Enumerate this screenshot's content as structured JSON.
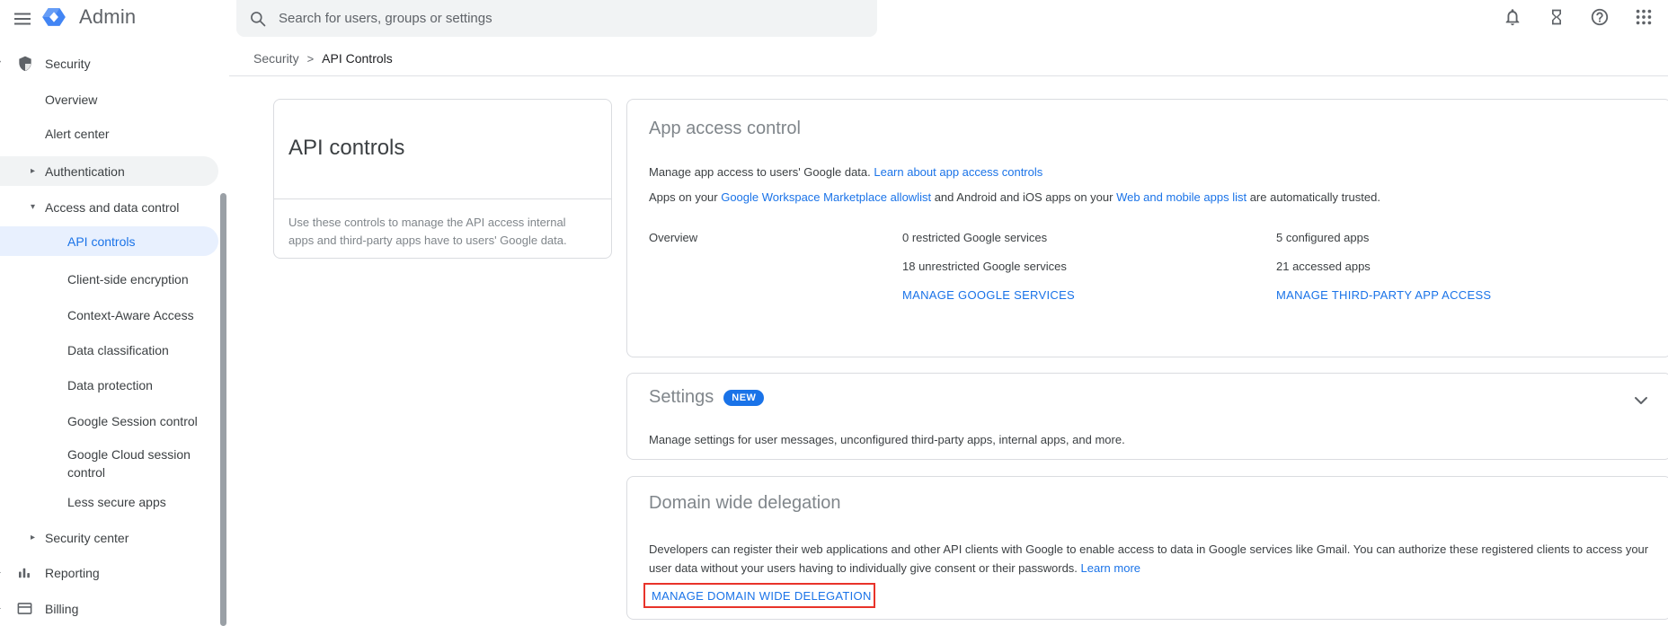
{
  "header": {
    "title": "Admin",
    "search_placeholder": "Search for users, groups or settings"
  },
  "icons": {
    "menu": "hamburger",
    "search": "magnifier",
    "notifications": "bell",
    "tasks": "hourglass",
    "help": "question-mark-circle",
    "apps": "3x3-dot-grid",
    "security": "shield",
    "reporting": "bar-chart",
    "billing": "credit-card",
    "caret_down": "▾",
    "caret_right": "▸",
    "chevron_down": "expand-chevron"
  },
  "breadcrumb": {
    "parent": "Security",
    "separator": ">",
    "current": "API Controls"
  },
  "sidebar": {
    "items": [
      {
        "label": "Security"
      },
      {
        "label": "Overview"
      },
      {
        "label": "Alert center"
      },
      {
        "label": "Authentication"
      },
      {
        "label": "Access and data control"
      },
      {
        "label": "API controls",
        "selected": true
      },
      {
        "label": "Client-side encryption"
      },
      {
        "label": "Context-Aware Access"
      },
      {
        "label": "Data classification"
      },
      {
        "label": "Data protection"
      },
      {
        "label": "Google Session control"
      },
      {
        "label": "Google Cloud session control"
      },
      {
        "label": "Less secure apps"
      },
      {
        "label": "Security center"
      },
      {
        "label": "Reporting"
      },
      {
        "label": "Billing"
      }
    ]
  },
  "api_controls_card": {
    "title": "API controls",
    "description": "Use these controls to manage the API access internal apps and third-party apps have to users' Google data."
  },
  "app_access_control": {
    "title": "App access control",
    "line1_text": "Manage app access to users' Google data. ",
    "line1_link": "Learn about app access controls",
    "line2_seg1": "Apps on your ",
    "line2_link1": "Google Workspace Marketplace allowlist",
    "line2_seg2": " and Android and iOS apps on your ",
    "line2_link2": "Web and mobile apps list",
    "line2_seg3": " are automatically trusted.",
    "overview_label": "Overview",
    "google_services_stat1": "0 restricted Google services",
    "google_services_stat2": "18 unrestricted Google services",
    "google_services_action": "MANAGE GOOGLE SERVICES",
    "apps_stat1": "5 configured apps",
    "apps_stat2": "21 accessed apps",
    "apps_action": "MANAGE THIRD-PARTY APP ACCESS"
  },
  "settings": {
    "title": "Settings",
    "badge": "NEW",
    "description": "Manage settings for user messages, unconfigured third-party apps, internal apps, and more."
  },
  "domain_wide_delegation": {
    "title": "Domain wide delegation",
    "description": "Developers can register their web applications and other API clients with Google to enable access to data in Google services like Gmail. You can authorize these registered clients to access your user data without your users having to individually give consent or their passwords. ",
    "link": "Learn more",
    "action": "MANAGE DOMAIN WIDE DELEGATION"
  },
  "colors": {
    "accent": "#1a73e8",
    "selected_bg": "#e8f0fe",
    "hover_bg": "#f1f3f4",
    "annotation_red": "#e8332a",
    "badge_bg": "#1a73e8"
  }
}
